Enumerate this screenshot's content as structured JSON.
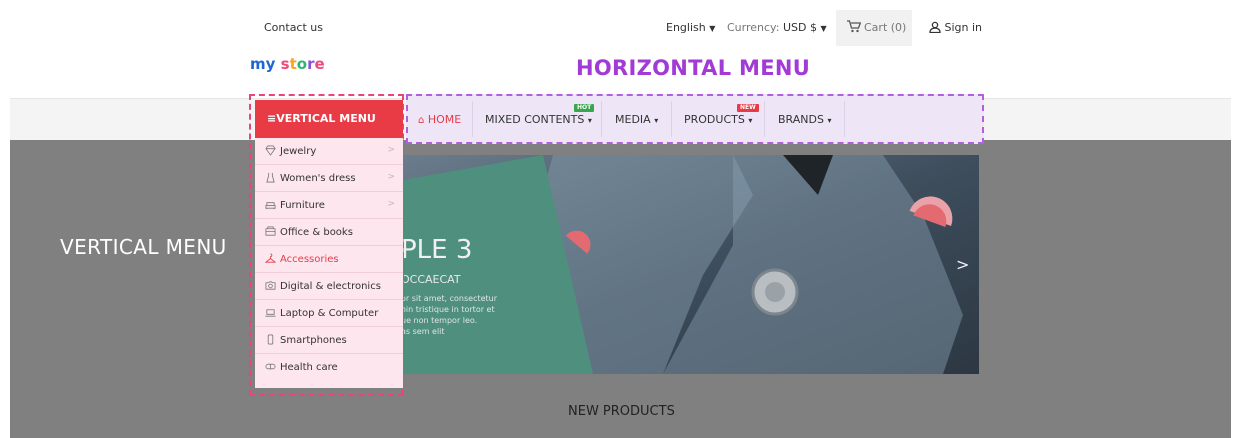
{
  "topbar": {
    "contact": "Contact us",
    "language": "English",
    "currency_label": "Currency:",
    "currency_value": "USD $",
    "cart": "Cart (0)",
    "signin": "Sign in"
  },
  "brand": {
    "logo_letters": [
      "m",
      "y",
      " ",
      "s",
      "t",
      "o",
      "r",
      "e"
    ],
    "logo_colors": [
      "#1f66d1",
      "#1f66d1",
      "#ffffff",
      "#f04a7a",
      "#f5a623",
      "#2bb673",
      "#8b4fd8",
      "#f04a7a"
    ],
    "horizontal_title": "HORIZONTAL MENU"
  },
  "vertical_menu": {
    "header": "VERTICAL MENU",
    "big_label": "VERTICAL MENU",
    "items": [
      {
        "label": "Jewelry",
        "icon": "diamond-icon",
        "has_children": true
      },
      {
        "label": "Women's dress",
        "icon": "dress-icon",
        "has_children": true
      },
      {
        "label": "Furniture",
        "icon": "sofa-icon",
        "has_children": true
      },
      {
        "label": "Office & books",
        "icon": "book-icon",
        "has_children": false
      },
      {
        "label": "Accessories",
        "icon": "hanger-icon",
        "has_children": false,
        "active": true
      },
      {
        "label": "Digital & electronics",
        "icon": "camera-icon",
        "has_children": false
      },
      {
        "label": "Laptop & Computer",
        "icon": "laptop-icon",
        "has_children": false
      },
      {
        "label": "Smartphones",
        "icon": "phone-icon",
        "has_children": false
      },
      {
        "label": "Health care",
        "icon": "pill-icon",
        "has_children": false
      }
    ],
    "chevron": ">"
  },
  "horizontal_menu": {
    "items": [
      {
        "label": "HOME",
        "icon": "home-icon",
        "active": true
      },
      {
        "label": "MIXED CONTENTS",
        "badge": "HOT",
        "badge_color": "#3aa64b",
        "dropdown": true
      },
      {
        "label": "MEDIA",
        "dropdown": true
      },
      {
        "label": "PRODUCTS",
        "badge": "NEW",
        "badge_color": "#e83b46",
        "dropdown": true
      },
      {
        "label": "BRANDS",
        "dropdown": true
      }
    ]
  },
  "slider": {
    "heading": "PLE 3",
    "subheading": "OCCAECAT",
    "body_lines": [
      "or sit amet, consectetur",
      "oin tristique in tortor et",
      "ue non tempor leo.",
      "as sem elit"
    ],
    "next_arrow": ">"
  },
  "sections": {
    "new_products": "NEW PRODUCTS"
  },
  "colors": {
    "accent_red": "#e83b46",
    "accent_purple": "#a23ad6",
    "dropdown_bg": "#fde6ee",
    "hero_gray": "#808080"
  }
}
